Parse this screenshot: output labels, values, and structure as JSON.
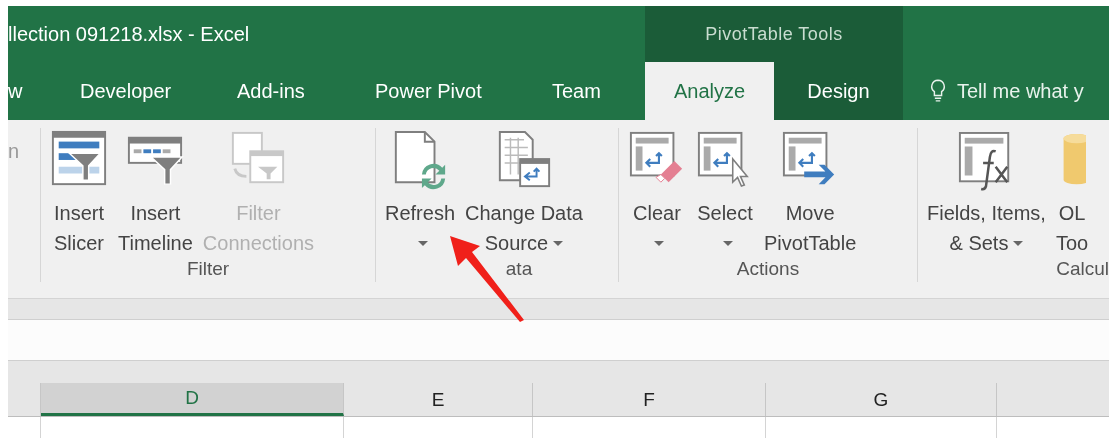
{
  "window": {
    "title": "llection 091218.xlsx - Excel",
    "context_tab_group": "PivotTable Tools"
  },
  "tabs": [
    {
      "label": "w",
      "selected": false,
      "contextual": false
    },
    {
      "label": "Developer",
      "selected": false,
      "contextual": false
    },
    {
      "label": "Add-ins",
      "selected": false,
      "contextual": false
    },
    {
      "label": "Power Pivot",
      "selected": false,
      "contextual": false
    },
    {
      "label": "Team",
      "selected": false,
      "contextual": false
    },
    {
      "label": "Analyze",
      "selected": true,
      "contextual": true
    },
    {
      "label": "Design",
      "selected": false,
      "contextual": true
    }
  ],
  "tell_me": {
    "placeholder": "Tell me what y"
  },
  "ribbon": {
    "groups": [
      {
        "partial_text": "n"
      },
      {
        "label": "Filter",
        "buttons": [
          {
            "kind": "slicer",
            "lines": [
              "Insert",
              "Slicer"
            ],
            "dropdown": false,
            "disabled": false
          },
          {
            "kind": "timeline",
            "lines": [
              "Insert",
              "Timeline"
            ],
            "dropdown": false,
            "disabled": false
          },
          {
            "kind": "connections",
            "lines": [
              "Filter",
              "Connections"
            ],
            "dropdown": false,
            "disabled": true
          }
        ]
      },
      {
        "label": "ata",
        "buttons": [
          {
            "kind": "refresh",
            "lines": [
              "Refresh"
            ],
            "dropdown": true,
            "disabled": false
          },
          {
            "kind": "source",
            "lines": [
              "Change Data",
              "Source"
            ],
            "dropdown": true,
            "disabled": false
          }
        ]
      },
      {
        "label": "Actions",
        "buttons": [
          {
            "kind": "clear",
            "lines": [
              "Clear"
            ],
            "dropdown": true,
            "disabled": false
          },
          {
            "kind": "select",
            "lines": [
              "Select"
            ],
            "dropdown": true,
            "disabled": false
          },
          {
            "kind": "move",
            "lines": [
              "Move",
              "PivotTable"
            ],
            "dropdown": false,
            "disabled": false
          }
        ]
      },
      {
        "label": "Calcul",
        "buttons": [
          {
            "kind": "fields",
            "lines": [
              "Fields, Items,",
              "& Sets"
            ],
            "dropdown": true,
            "disabled": false
          },
          {
            "kind": "olap",
            "lines": [
              "OL",
              "Too"
            ],
            "dropdown": false,
            "disabled": false
          }
        ]
      }
    ]
  },
  "sheet": {
    "columns": [
      {
        "label": "D",
        "selected": true
      },
      {
        "label": "E",
        "selected": false
      },
      {
        "label": "F",
        "selected": false
      },
      {
        "label": "G",
        "selected": false
      }
    ]
  },
  "annotation": {
    "kind": "arrow"
  }
}
